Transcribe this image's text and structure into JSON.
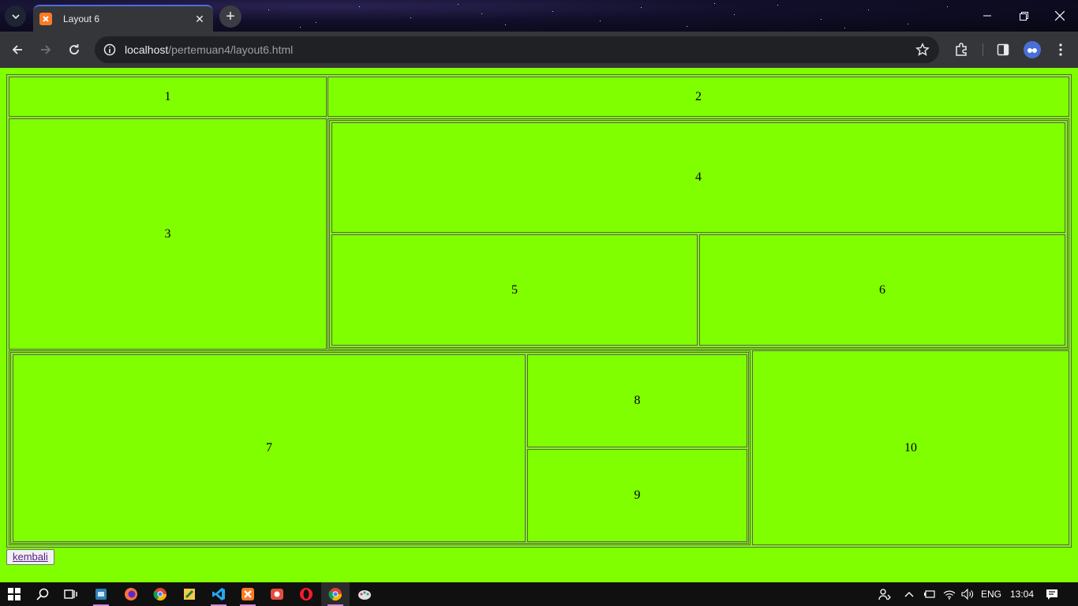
{
  "browser": {
    "tab": {
      "title": "Layout 6"
    },
    "url": {
      "host": "localhost",
      "path": "/pertemuan4/layout6.html"
    }
  },
  "page": {
    "background": "#80ff00",
    "cells": {
      "c1": "1",
      "c2": "2",
      "c3": "3",
      "c4": "4",
      "c5": "5",
      "c6": "6",
      "c7": "7",
      "c8": "8",
      "c9": "9",
      "c10": "10"
    },
    "back_link": "kembali"
  },
  "taskbar": {
    "language": "ENG",
    "time": "13:04",
    "apps": [
      "start-icon",
      "search-icon",
      "task-view-icon",
      "explorer-icon",
      "firefox-icon",
      "chrome-icon",
      "sticky-app-icon",
      "vscode-icon",
      "xampp-icon",
      "snip-icon",
      "opera-icon",
      "chrome-icon",
      "paint-icon"
    ]
  }
}
